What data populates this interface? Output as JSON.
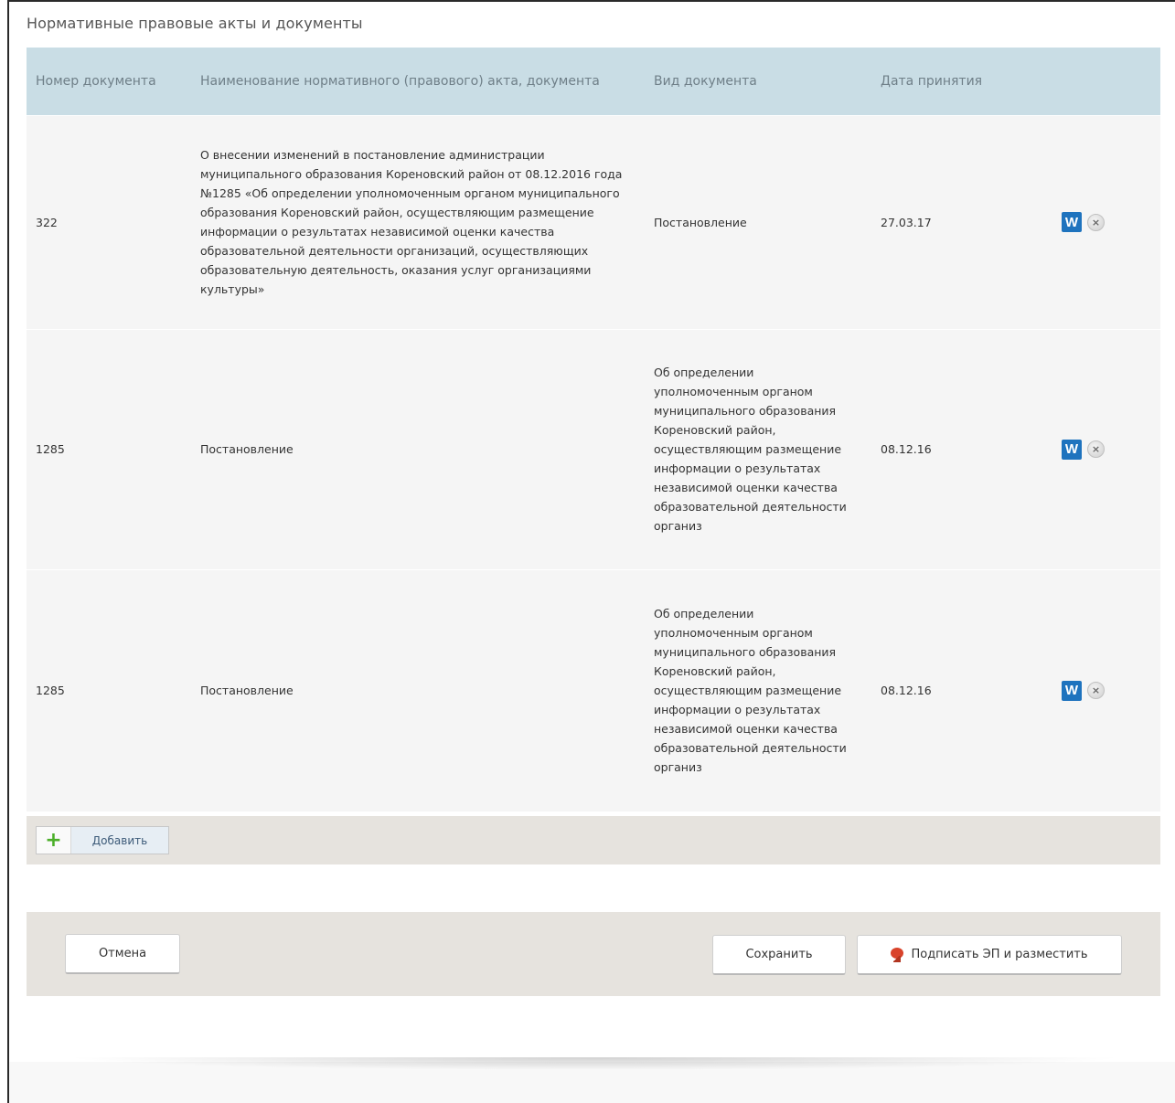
{
  "section": {
    "title": "Нормативные правовые акты и документы"
  },
  "table": {
    "headers": {
      "number": "Номер документа",
      "name": "Наименование нормативного (правового) акта, документа",
      "type": "Вид документа",
      "date": "Дата принятия"
    },
    "rows": [
      {
        "number": "322",
        "name": "О внесении изменений в постановление администрации муниципального образования Кореновский район от 08.12.2016 года №1285 «Об определении уполномоченным органом муниципального образования Кореновский район, осуществляющим размещение информации о результатах независимой оценки качества образовательной деятельности организаций, осуществляющих образовательную деятельность, оказания услуг организациями культуры»",
        "type": "Постановление",
        "date": "27.03.17"
      },
      {
        "number": "1285",
        "name": "Постановление",
        "type": "Об определении уполномоченным органом муниципального образования Кореновский район, осуществляющим размещение информации о результатах независимой оценки качества образовательной деятельности организ",
        "date": "08.12.16"
      },
      {
        "number": "1285",
        "name": "Постановление",
        "type": "Об определении уполномоченным органом муниципального образования Кореновский район, осуществляющим размещение информации о результатах независимой оценки качества образовательной деятельности организ",
        "date": "08.12.16"
      }
    ],
    "word_icon_label": "W",
    "delete_icon_label": "×"
  },
  "add_button": {
    "label": "Добавить",
    "icon": "+"
  },
  "actions": {
    "cancel_label": "Отмена",
    "save_label": "Сохранить",
    "sign_label": "Подписать ЭП и разместить"
  }
}
